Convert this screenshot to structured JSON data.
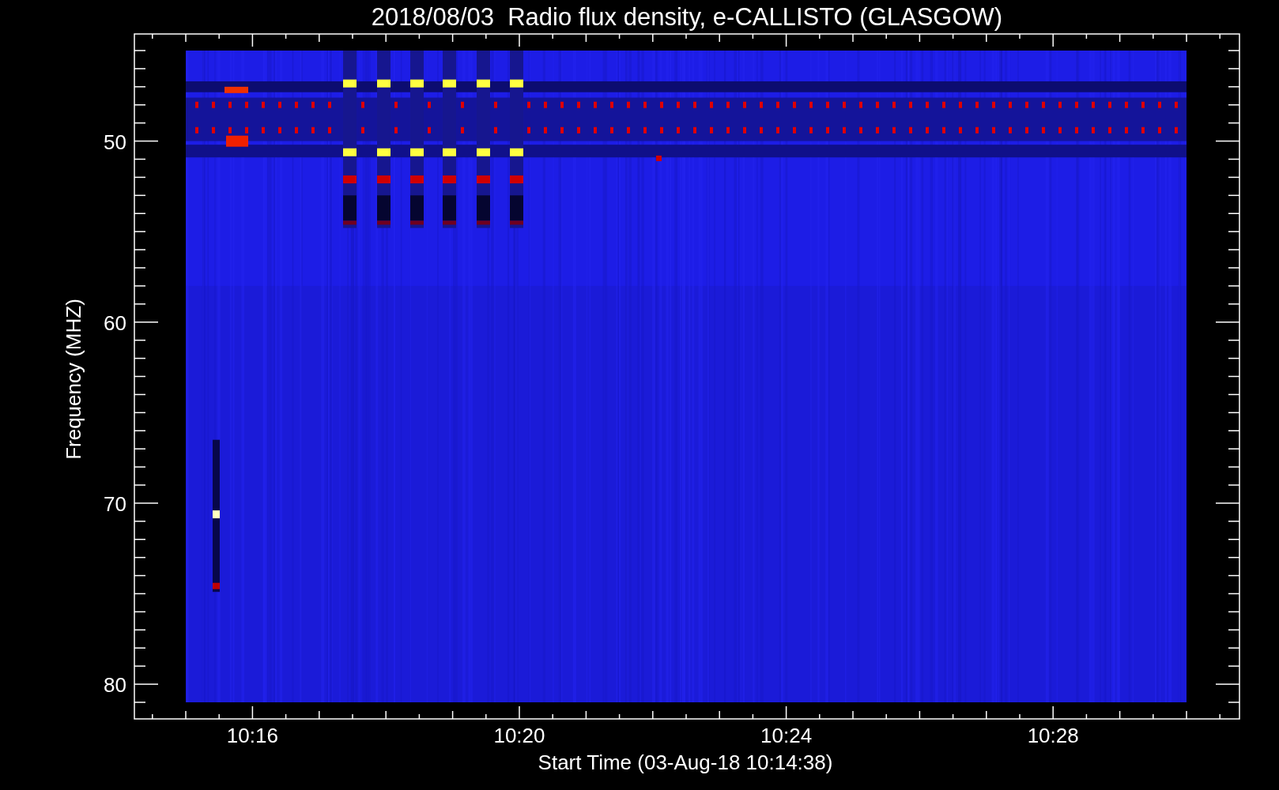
{
  "title": "2018/08/03  Radio flux density, e-CALLISTO (GLASGOW)",
  "x_axis": {
    "label": "Start Time (03-Aug-18 10:14:38)",
    "ticks": [
      "10:16",
      "10:20",
      "10:24",
      "10:28"
    ]
  },
  "y_axis": {
    "label": "Frequency (MHZ)",
    "ticks": [
      "50",
      "60",
      "70",
      "80"
    ]
  }
}
